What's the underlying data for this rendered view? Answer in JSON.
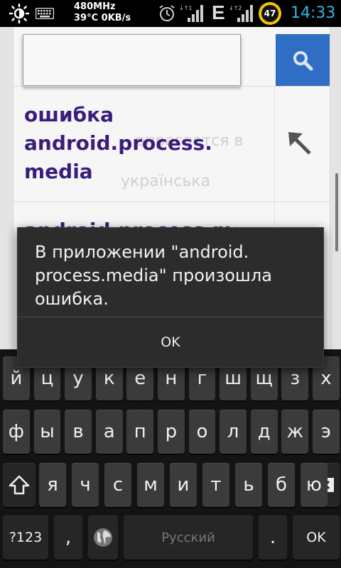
{
  "status_bar": {
    "cpu_freq": "480MHz",
    "temp_speed": "39°C 0KB/s",
    "network_type": "E",
    "battery_level": "47",
    "time": "14:33",
    "icons": [
      "brightness-icon",
      "keyboard-icon",
      "alarm-icon",
      "signal-icon",
      "signal-2-icon"
    ],
    "accent_color": "#33b5e5",
    "battery_color": "#f5c400"
  },
  "browser": {
    "search_placeholder": "",
    "search_button_icon": "search-icon",
    "suggestion_1": "ошибка android.process. media",
    "suggestion_2": "android.process.media",
    "ghost_text_1": "рпрагается в",
    "ghost_text_2": "українська",
    "search_button_color": "#2f6ec4",
    "link_color": "#3a1d7a"
  },
  "dialog": {
    "message": "В приложении \"android. process.media\" произошла ошибка.",
    "ok_label": "OK"
  },
  "keyboard": {
    "row1": [
      "й",
      "ц",
      "у",
      "к",
      "е",
      "н",
      "г",
      "ш",
      "щ",
      "з",
      "х"
    ],
    "row2": [
      "ф",
      "ы",
      "в",
      "а",
      "п",
      "р",
      "о",
      "л",
      "д",
      "ж",
      "э"
    ],
    "row3": [
      "я",
      "ч",
      "с",
      "м",
      "и",
      "т",
      "ь",
      "б",
      "ю"
    ],
    "shift_icon": "shift-icon",
    "backspace_icon": "backspace-icon",
    "symbols_label": "?123",
    "comma_label": ",",
    "language_icon": "globe-icon",
    "space_label": "Русский",
    "period_label": ".",
    "ok_label": "OK"
  }
}
